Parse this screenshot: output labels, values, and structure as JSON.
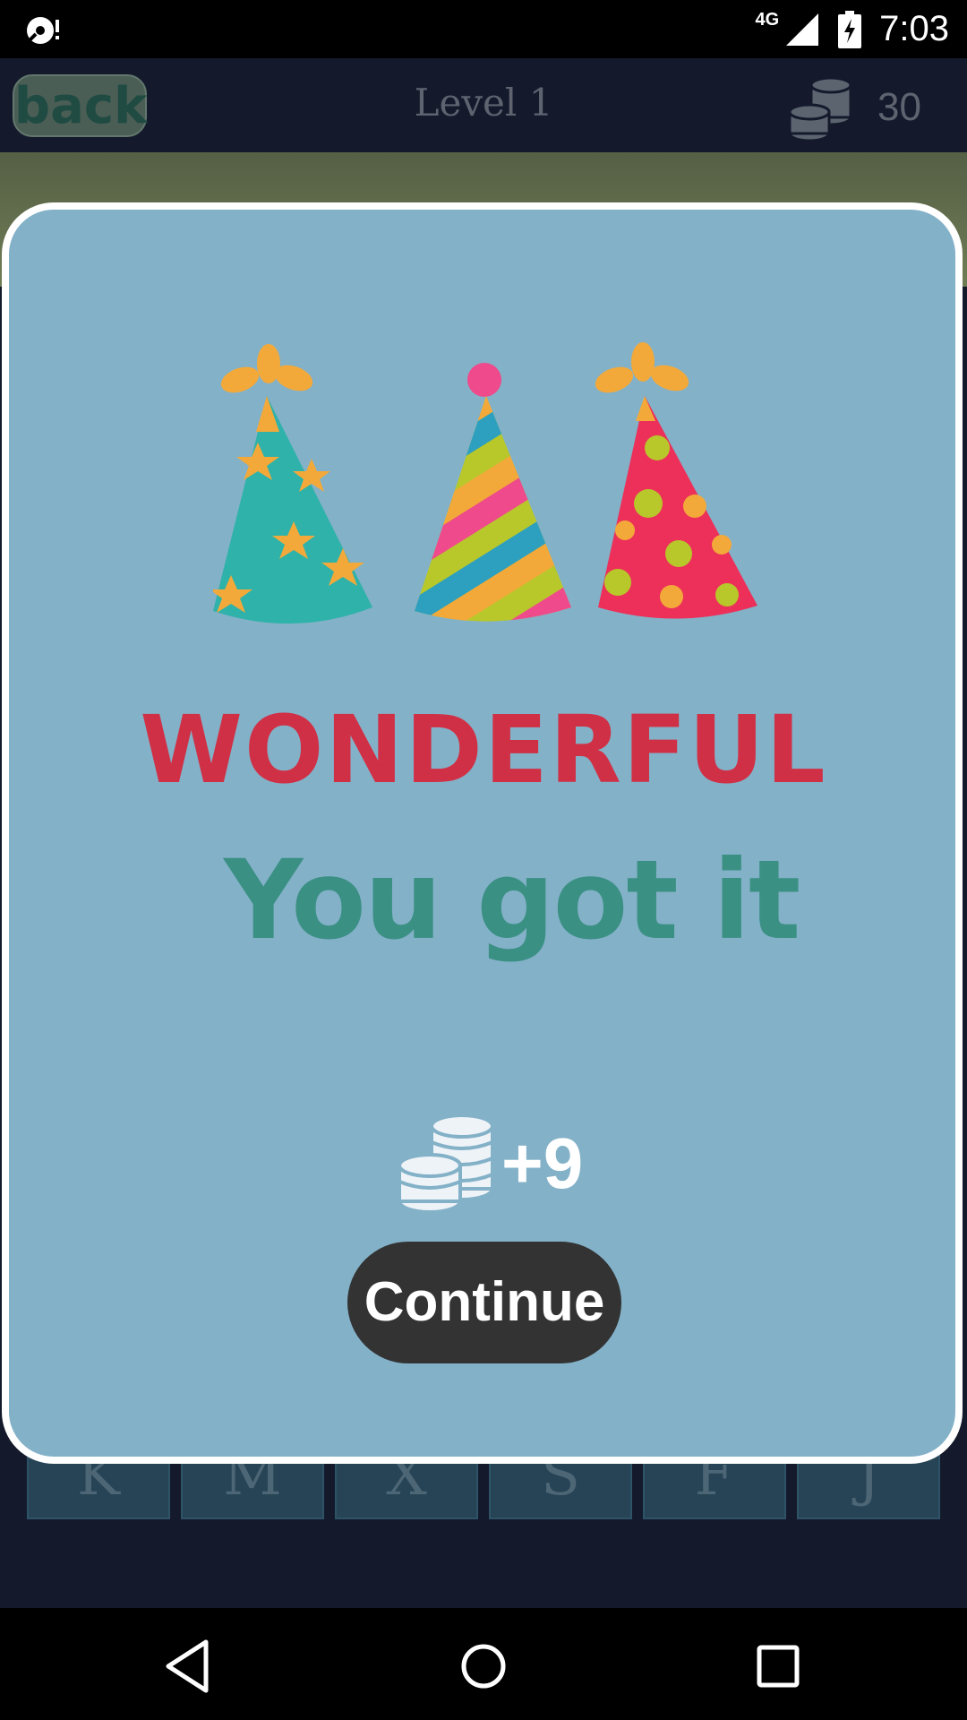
{
  "status_bar": {
    "network": "4G",
    "time": "7:03"
  },
  "header": {
    "back_label": "back",
    "title": "Level 1",
    "coins": "30"
  },
  "game": {
    "letters": [
      "K",
      "M",
      "X",
      "S",
      "F",
      "J"
    ]
  },
  "dialog": {
    "headline": "WONDERFUL",
    "subline": "You got it",
    "reward": "+9",
    "continue_label": "Continue"
  },
  "colors": {
    "dialog_bg": "#83b1c8",
    "headline": "#d03045",
    "subline": "#3b9084",
    "continue_bg": "#333333"
  }
}
